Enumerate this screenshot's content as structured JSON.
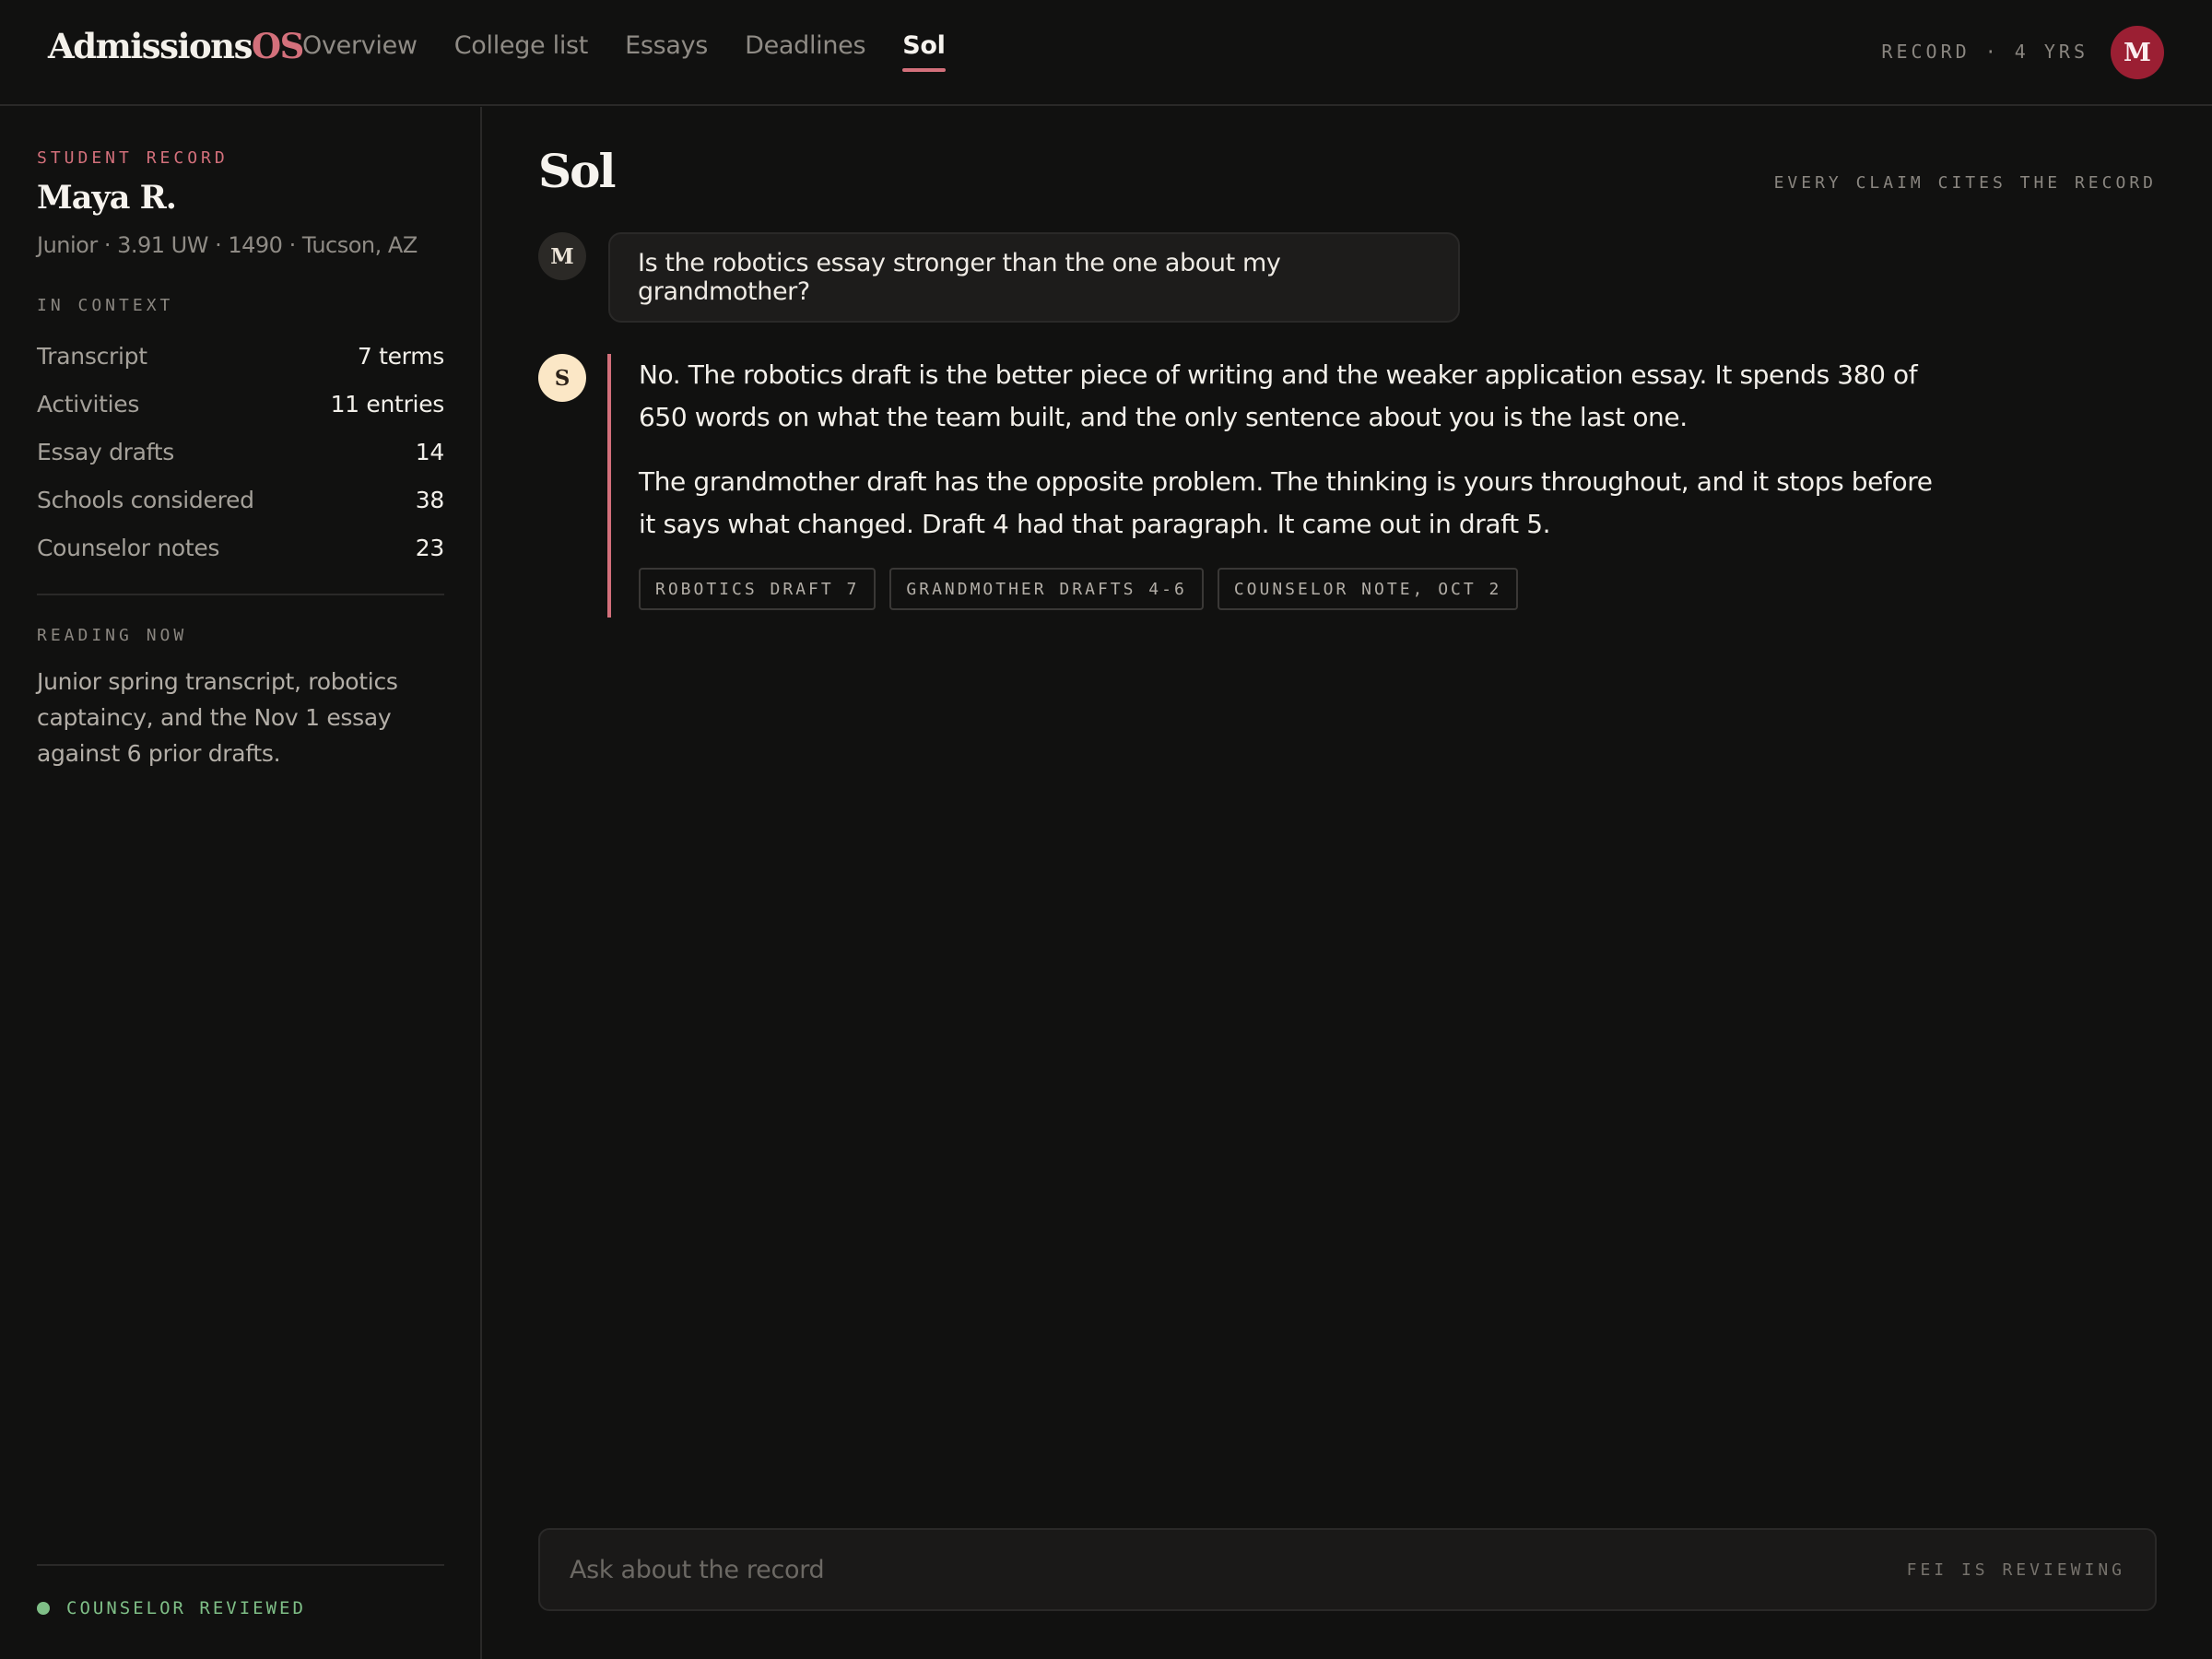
{
  "app": {
    "logo_main": "Admissions",
    "logo_accent": "OS",
    "record_meta": "RECORD · 4 YRS",
    "user_initial": "M",
    "accent_color": "#d3707b",
    "avatar_color": "#9b1f33"
  },
  "nav": {
    "items": [
      {
        "label": "Overview",
        "active": false
      },
      {
        "label": "College list",
        "active": false
      },
      {
        "label": "Essays",
        "active": false
      },
      {
        "label": "Deadlines",
        "active": false
      },
      {
        "label": "Sol",
        "active": true
      }
    ]
  },
  "sidebar": {
    "record_label": "STUDENT RECORD",
    "student_name": "Maya R.",
    "student_meta": "Junior · 3.91 UW · 1490 · Tucson, AZ",
    "context_label": "IN CONTEXT",
    "stats": [
      {
        "label": "Transcript",
        "value": "7 terms"
      },
      {
        "label": "Activities",
        "value": "11 entries"
      },
      {
        "label": "Essay drafts",
        "value": "14"
      },
      {
        "label": "Schools considered",
        "value": "38"
      },
      {
        "label": "Counselor notes",
        "value": "23"
      }
    ],
    "reading_label": "READING NOW",
    "reading_text": "Junior spring transcript, robotics captaincy, and the Nov 1 essay against 6 prior drafts.",
    "status_text": "COUNSELOR REVIEWED",
    "status_color": "#7fbf87"
  },
  "main": {
    "title": "Sol",
    "note": "EVERY CLAIM CITES THE RECORD",
    "user_message": {
      "initial": "M",
      "text": "Is the robotics essay stronger than the one about my grandmother?"
    },
    "sol_message": {
      "initial": "S",
      "paragraphs": [
        "No. The robotics draft is the better piece of writing and the weaker application essay. It spends 380 of 650 words on what the team built, and the only sentence about you is the last one.",
        "The grandmother draft has the opposite problem. The thinking is yours throughout, and it stops before it says what changed. Draft 4 had that paragraph. It came out in draft 5."
      ],
      "citations": [
        "ROBOTICS DRAFT 7",
        "GRANDMOTHER DRAFTS 4-6",
        "COUNSELOR NOTE, OCT 2"
      ]
    },
    "composer": {
      "placeholder": "Ask about the record",
      "value": "",
      "status": "FEI IS REVIEWING"
    }
  }
}
